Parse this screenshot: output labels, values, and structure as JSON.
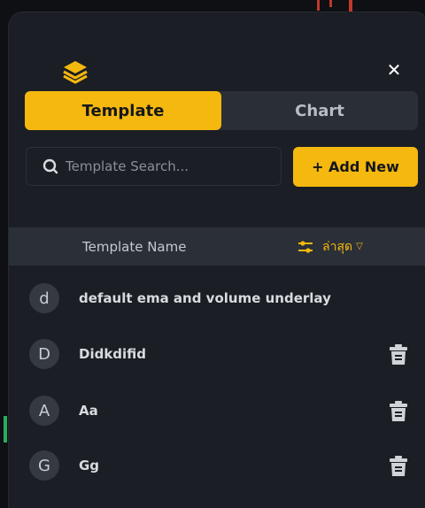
{
  "tabs": [
    {
      "label": "Template",
      "active": true
    },
    {
      "label": "Chart",
      "active": false
    }
  ],
  "search": {
    "placeholder": "Template Search..."
  },
  "add_button": {
    "label": "+ Add New"
  },
  "list_header": {
    "name_label": "Template Name",
    "sort_label": "ล่าสุด"
  },
  "templates": [
    {
      "initial": "d",
      "name": "default ema and volume underlay",
      "deletable": false
    },
    {
      "initial": "D",
      "name": "Didkdifid",
      "deletable": true
    },
    {
      "initial": "A",
      "name": "Aa",
      "deletable": true
    },
    {
      "initial": "G",
      "name": "Gg",
      "deletable": true
    }
  ],
  "colors": {
    "accent": "#f5b80f",
    "panel": "#1b1e24",
    "header": "#2b2f37"
  },
  "icons": {
    "logo": "layers-icon",
    "close": "close-icon",
    "search": "search-icon",
    "sort": "sliders-icon",
    "delete": "trash-icon"
  }
}
